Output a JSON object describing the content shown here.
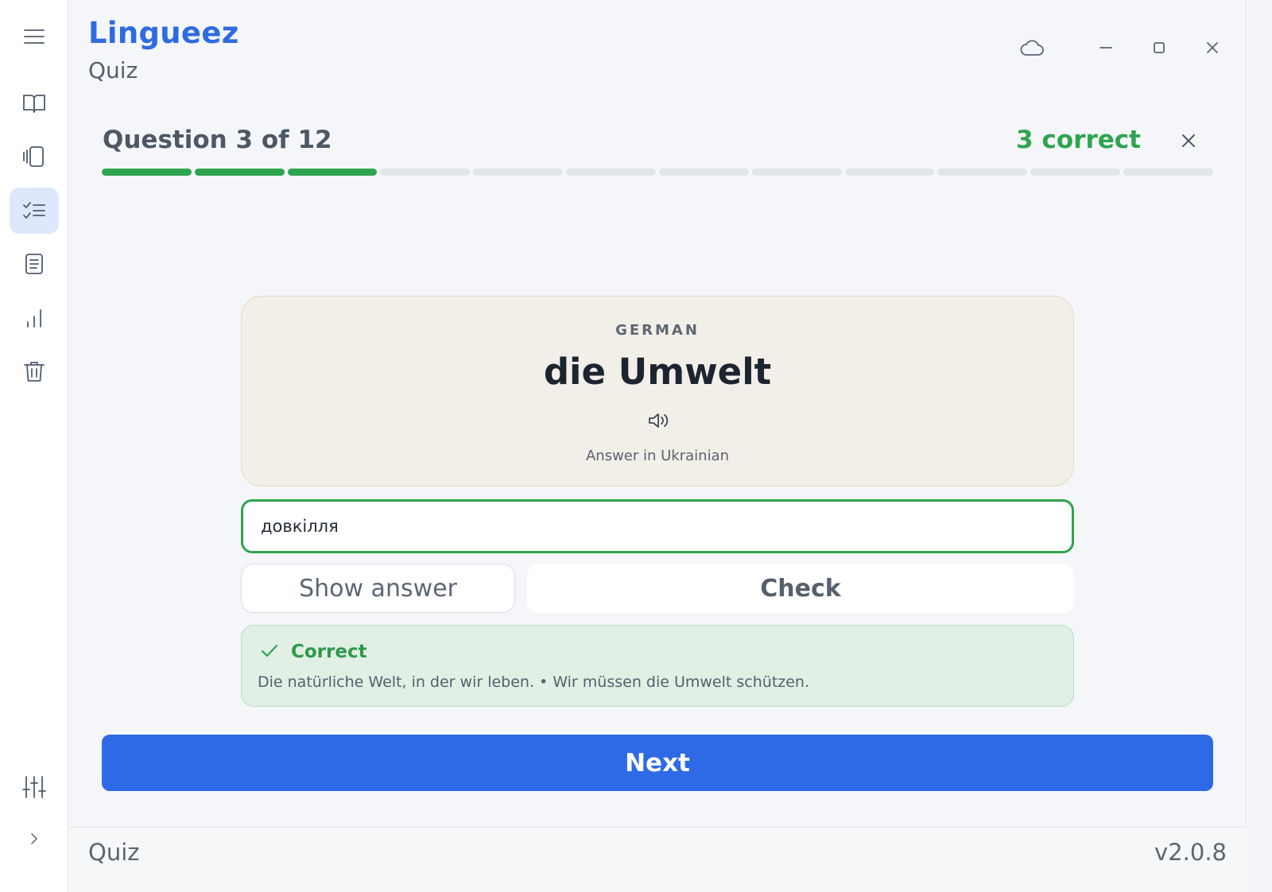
{
  "app": {
    "title": "Lingueez",
    "subtitle": "Quiz"
  },
  "sidebar": {
    "items": [
      {
        "name": "menu",
        "icon": "hamburger-menu-icon"
      },
      {
        "name": "dictionary",
        "icon": "open-book-icon"
      },
      {
        "name": "flashcards",
        "icon": "cards-icon"
      },
      {
        "name": "quiz",
        "icon": "checklist-icon",
        "active": true
      },
      {
        "name": "notes",
        "icon": "document-icon"
      },
      {
        "name": "statistics",
        "icon": "bar-chart-icon"
      },
      {
        "name": "trash",
        "icon": "trash-icon"
      },
      {
        "name": "settings",
        "icon": "sliders-icon"
      },
      {
        "name": "expand",
        "icon": "chevron-right-icon"
      }
    ]
  },
  "window_controls": {
    "sync_icon": "cloud-icon",
    "minimize_icon": "minimize-icon",
    "maximize_icon": "maximize-icon",
    "close_icon": "close-icon"
  },
  "quiz": {
    "question_label": "Question 3 of 12",
    "correct_label": "3 correct",
    "total_questions": 12,
    "completed": 3,
    "card": {
      "language": "GERMAN",
      "word": "die Umwelt",
      "hint": "Answer in Ukrainian"
    },
    "answer_value": "довкілля",
    "show_answer_label": "Show answer",
    "check_label": "Check",
    "feedback": {
      "title": "Correct",
      "text": "Die natürliche Welt, in der wir leben. • Wir müssen die Umwelt schützen."
    },
    "next_label": "Next"
  },
  "statusbar": {
    "left": "Quiz",
    "right": "v2.0.8"
  },
  "colors": {
    "accent": "#2e6ae6",
    "success": "#2fa44f",
    "card_bg": "#f2eee8"
  }
}
